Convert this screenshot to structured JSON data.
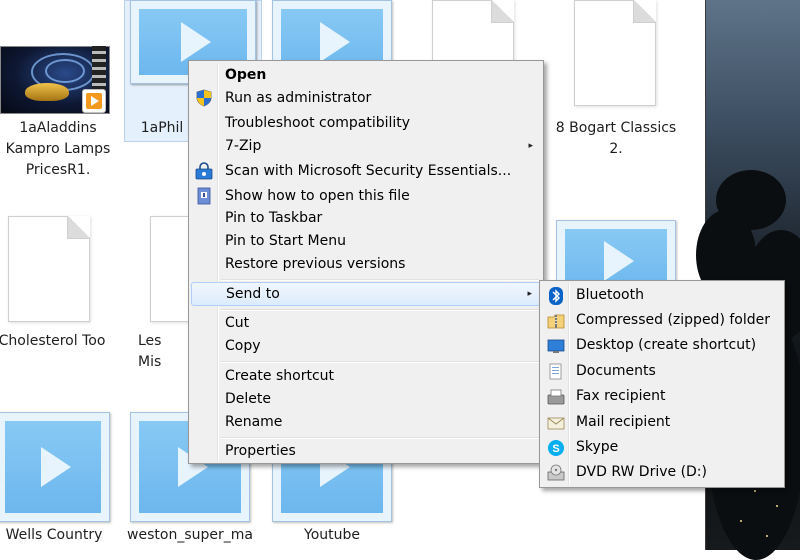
{
  "desktop_icons": [
    {
      "id": "aladdin",
      "label": "1aAladdins\nKampro Lamps\nPricesR1.",
      "kind": "video-photo"
    },
    {
      "id": "phil",
      "label": "1aPhil",
      "kind": "video",
      "selected": true
    },
    {
      "id": "video3",
      "label": "",
      "kind": "video"
    },
    {
      "id": "doc-top",
      "label": "",
      "kind": "document"
    },
    {
      "id": "bogart",
      "label": "8 Bogart Classics\n2.",
      "kind": "document"
    },
    {
      "id": "cholesterol",
      "label": "Cholesterol Too",
      "kind": "document"
    },
    {
      "id": "lesmis",
      "label": "Les Mis",
      "kind": "document"
    },
    {
      "id": "video-mid",
      "label": "",
      "kind": "video"
    },
    {
      "id": "wells",
      "label": "Wells Country",
      "kind": "video"
    },
    {
      "id": "weston",
      "label": "weston_super_ma",
      "kind": "video"
    },
    {
      "id": "youtube",
      "label": "Youtube",
      "kind": "video"
    }
  ],
  "context_menu": {
    "items": [
      {
        "label": "Open",
        "bold": true,
        "icon": "none"
      },
      {
        "label": "Run as administrator",
        "icon": "uac-shield-icon"
      },
      {
        "label": "Troubleshoot compatibility",
        "icon": "none"
      },
      {
        "label": "7-Zip",
        "icon": "none",
        "submenu": true
      },
      {
        "label": "Scan with Microsoft Security Essentials...",
        "icon": "security-essentials-icon"
      },
      {
        "label": "Show how to open this file",
        "icon": "help-open-icon"
      },
      {
        "label": "Pin to Taskbar",
        "icon": "none"
      },
      {
        "label": "Pin to Start Menu",
        "icon": "none"
      },
      {
        "label": "Restore previous versions",
        "icon": "none"
      },
      {
        "label": "Send to",
        "icon": "none",
        "submenu": true,
        "highlighted": true
      },
      {
        "label": "Cut",
        "icon": "none"
      },
      {
        "label": "Copy",
        "icon": "none"
      },
      {
        "label": "Create shortcut",
        "icon": "none"
      },
      {
        "label": "Delete",
        "icon": "none"
      },
      {
        "label": "Rename",
        "icon": "none"
      },
      {
        "label": "Properties",
        "icon": "none"
      }
    ],
    "submenu_arrow": "▸"
  },
  "send_to_menu": {
    "items": [
      {
        "label": "Bluetooth",
        "icon": "bluetooth-icon"
      },
      {
        "label": "Compressed (zipped) folder",
        "icon": "zip-folder-icon"
      },
      {
        "label": "Desktop (create shortcut)",
        "icon": "desktop-icon"
      },
      {
        "label": "Documents",
        "icon": "documents-icon"
      },
      {
        "label": "Fax recipient",
        "icon": "fax-icon"
      },
      {
        "label": "Mail recipient",
        "icon": "mail-icon"
      },
      {
        "label": "Skype",
        "icon": "skype-icon"
      },
      {
        "label": "DVD RW Drive (D:)",
        "icon": "dvd-drive-icon"
      }
    ]
  },
  "colors": {
    "menu_bg": "#f0f0f0",
    "menu_border": "#979797",
    "hover_border": "#aecff7",
    "selection": "#cfe4fa",
    "play_blue": "#6cb7ee",
    "bluetooth": "#0a64c8",
    "skype": "#00aff0"
  }
}
